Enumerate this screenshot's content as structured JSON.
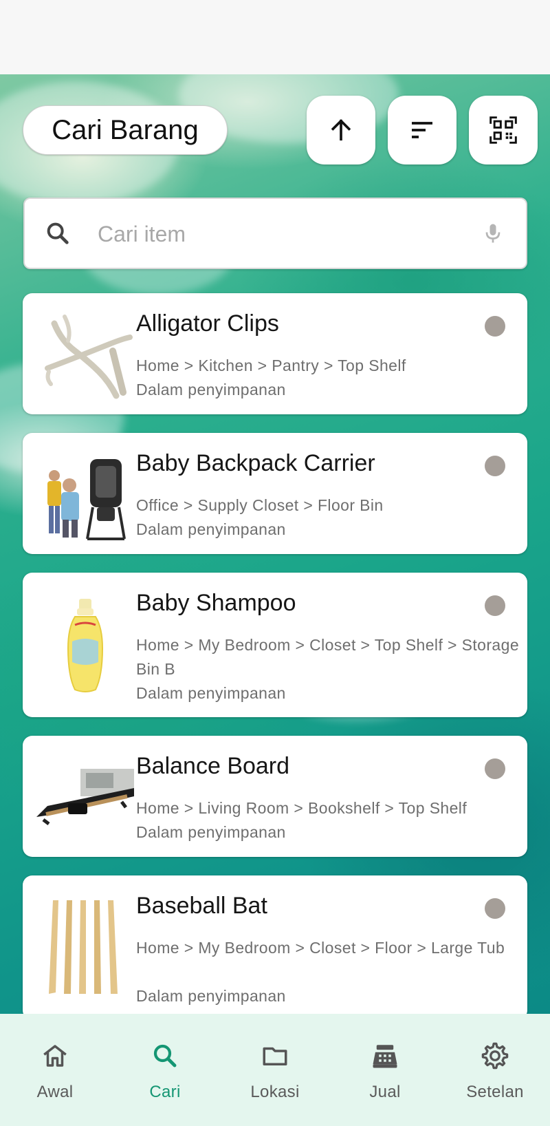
{
  "header": {
    "title": "Cari Barang",
    "sort_direction_icon": "arrow-up-icon",
    "filter_icon": "sort-lines-icon",
    "scan_icon": "qr-code-icon"
  },
  "search": {
    "placeholder": "Cari item",
    "value": ""
  },
  "items": [
    {
      "name": "Alligator Clips",
      "path": "Home > Kitchen > Pantry > Top Shelf",
      "status": "Dalam penyimpanan"
    },
    {
      "name": "Baby Backpack Carrier",
      "path": "Office > Supply Closet > Floor Bin",
      "status": "Dalam penyimpanan"
    },
    {
      "name": "Baby Shampoo",
      "path": "Home > My Bedroom > Closet > Top Shelf > Storage Bin B",
      "status": "Dalam penyimpanan"
    },
    {
      "name": "Balance Board",
      "path": "Home > Living Room > Bookshelf > Top Shelf",
      "status": "Dalam penyimpanan"
    },
    {
      "name": "Baseball Bat",
      "path": "Home > My Bedroom > Closet > Floor > Large Tub",
      "status": "Dalam penyimpanan"
    }
  ],
  "nav": {
    "items": [
      {
        "label": "Awal",
        "icon": "home-icon"
      },
      {
        "label": "Cari",
        "icon": "search-icon"
      },
      {
        "label": "Lokasi",
        "icon": "folder-icon"
      },
      {
        "label": "Jual",
        "icon": "cash-register-icon"
      },
      {
        "label": "Setelan",
        "icon": "gear-icon"
      }
    ],
    "active": "Cari"
  },
  "colors": {
    "accent": "#149673",
    "status_dot": "#a59e98",
    "nav_background": "#e4f6ee"
  }
}
